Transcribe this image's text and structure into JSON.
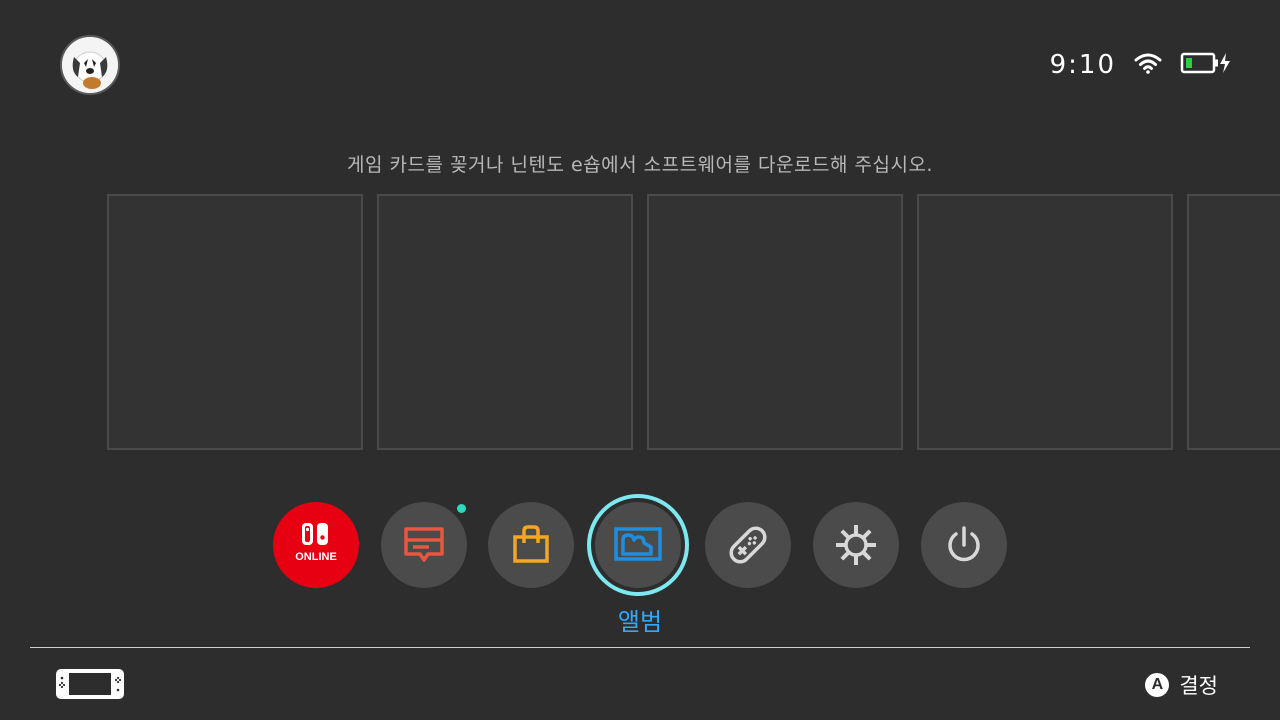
{
  "header": {
    "avatar_name": "user-avatar",
    "time": "9:10",
    "wifi_icon": "wifi-icon",
    "battery_icon": "battery-charging-icon",
    "battery_color": "#28d23c"
  },
  "main": {
    "hint": "게임 카드를 꽂거나 닌텐도 e숍에서 소프트웨어를 다운로드해 주십시오."
  },
  "dock": {
    "items": [
      {
        "name": "nintendo-switch-online",
        "icon": "switch-online-icon",
        "text": "ONLINE"
      },
      {
        "name": "news",
        "icon": "news-icon",
        "has_notification": true
      },
      {
        "name": "eshop",
        "icon": "shopping-bag-icon"
      },
      {
        "name": "album",
        "icon": "album-icon",
        "label": "앨범",
        "selected": true
      },
      {
        "name": "controllers",
        "icon": "joycon-icon"
      },
      {
        "name": "system-settings",
        "icon": "gear-icon"
      },
      {
        "name": "sleep-mode",
        "icon": "power-icon"
      }
    ],
    "selected_label": "앨범"
  },
  "footer": {
    "console_icon": "handheld-console-icon",
    "a_button": "A",
    "action_label": "결정"
  },
  "colors": {
    "background": "#2d2d2d",
    "accent": "#2fa9ff",
    "selection_ring": "#7de8ef",
    "online_red": "#e60012",
    "news_orange": "#e8573f",
    "eshop_yellow": "#f5a623",
    "album_blue": "#1e8fe0"
  }
}
